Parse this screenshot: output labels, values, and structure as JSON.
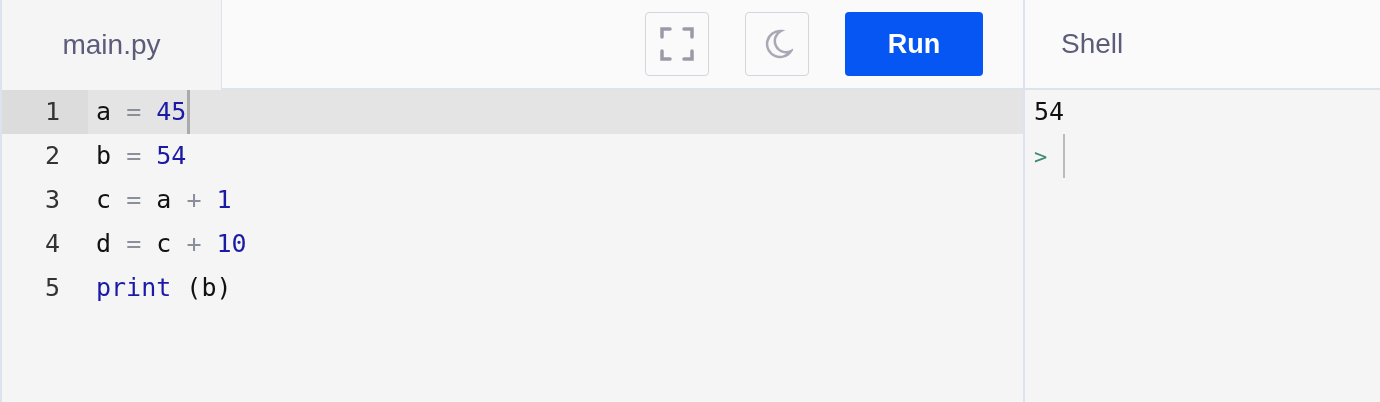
{
  "file_tab": {
    "label": "main.py",
    "selected": true
  },
  "toolbar": {
    "run_button": "Run"
  },
  "editor": {
    "lines": [
      {
        "number": "1",
        "selected": true,
        "tokens": [
          {
            "text": "a",
            "kind": "name"
          },
          {
            "text": "=",
            "kind": "op"
          },
          {
            "text": "45",
            "kind": "num"
          }
        ]
      },
      {
        "number": "2",
        "selected": false,
        "tokens": [
          {
            "text": "b",
            "kind": "name"
          },
          {
            "text": "=",
            "kind": "op"
          },
          {
            "text": "54",
            "kind": "num"
          }
        ]
      },
      {
        "number": "3",
        "selected": false,
        "tokens": [
          {
            "text": "c",
            "kind": "name"
          },
          {
            "text": "=",
            "kind": "op"
          },
          {
            "text": "a",
            "kind": "name"
          },
          {
            "text": "+",
            "kind": "op"
          },
          {
            "text": "1",
            "kind": "num"
          }
        ]
      },
      {
        "number": "4",
        "selected": false,
        "tokens": [
          {
            "text": "d",
            "kind": "name"
          },
          {
            "text": "=",
            "kind": "op"
          },
          {
            "text": "c",
            "kind": "name"
          },
          {
            "text": "+",
            "kind": "op"
          },
          {
            "text": "10",
            "kind": "num"
          }
        ]
      },
      {
        "number": "5",
        "selected": false,
        "tokens": [
          {
            "text": "print",
            "kind": "keyword"
          },
          {
            "text": "(b)",
            "kind": "name"
          }
        ]
      }
    ]
  },
  "shell": {
    "title": "Shell",
    "output": [
      "54"
    ],
    "prompt": ">"
  }
}
